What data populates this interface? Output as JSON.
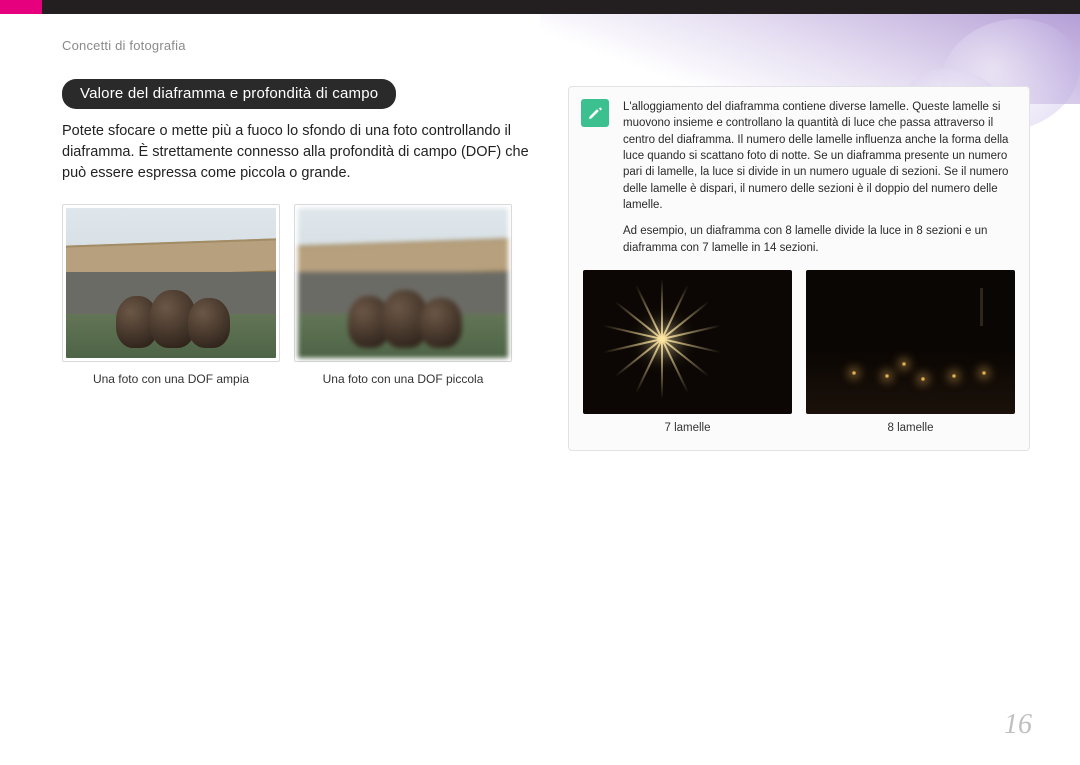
{
  "breadcrumb": "Concetti di fotografia",
  "heading": "Valore del diaframma e profondità di campo",
  "intro": "Potete sfocare o mette più a fuoco lo sfondo di una foto controllando il diaframma. È strettamente connesso alla profondità di campo (DOF) che può essere espressa come piccola o grande.",
  "dof": {
    "wide_caption": "Una foto con una DOF ampia",
    "narrow_caption": "Una foto con una DOF piccola"
  },
  "note": {
    "icon_name": "pen-icon",
    "para1": "L'alloggiamento del diaframma contiene diverse lamelle. Queste lamelle si muovono insieme e controllano la quantità di luce che passa attraverso il centro del diaframma. Il numero delle lamelle influenza anche la forma della luce quando si scattano foto di notte. Se un diaframma presente un numero pari di lamelle, la luce si divide in un numero uguale di sezioni. Se il numero delle lamelle è dispari, il numero delle sezioni è il doppio del numero delle lamelle.",
    "para2": "Ad esempio, un diaframma con 8 lamelle divide la luce in 8 sezioni e un diaframma con 7 lamelle in 14 sezioni.",
    "blade7_caption": "7 lamelle",
    "blade8_caption": "8 lamelle"
  },
  "page_number": "16"
}
